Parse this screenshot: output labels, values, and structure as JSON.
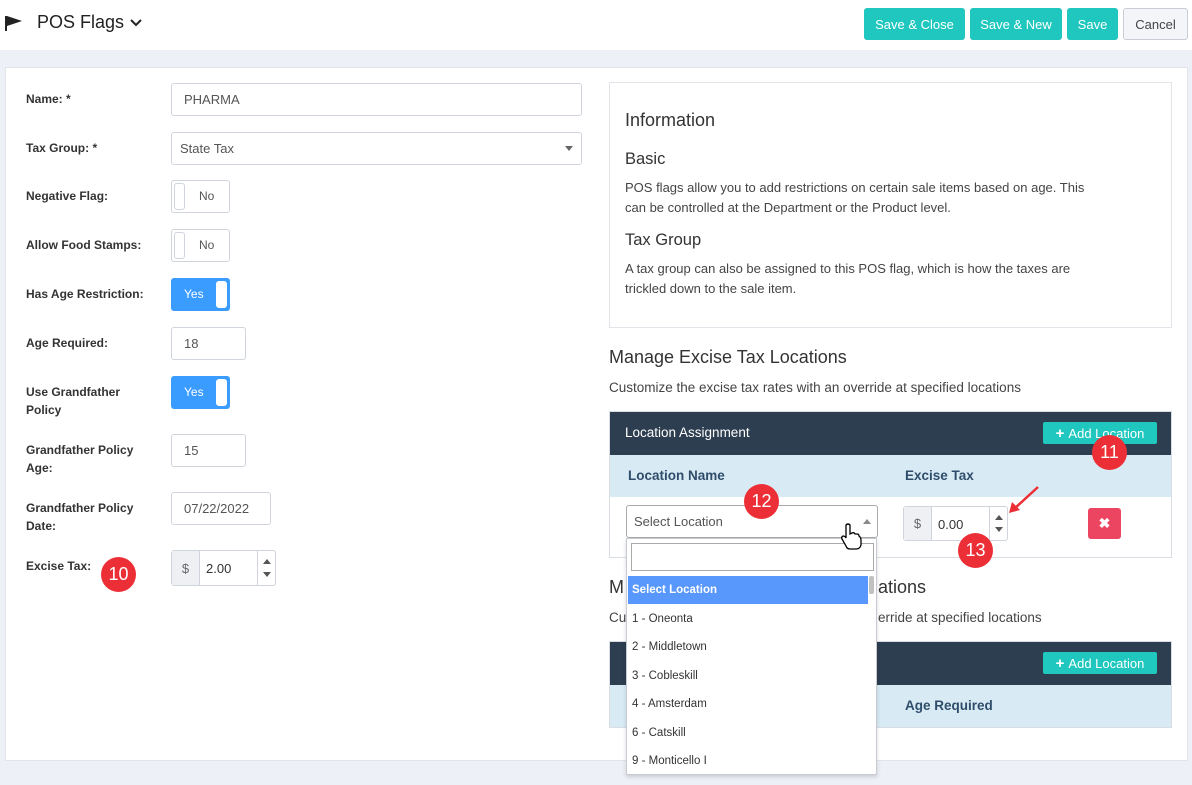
{
  "header": {
    "title": "POS Flags",
    "buttons": {
      "save_close": "Save & Close",
      "save_new": "Save & New",
      "save": "Save",
      "cancel": "Cancel"
    },
    "accent_color": "#1fc7be"
  },
  "form": {
    "name_label": "Name: *",
    "name_value": "PHARMA",
    "tax_group_label": "Tax Group: *",
    "tax_group_value": "State Tax",
    "negative_flag_label": "Negative Flag:",
    "negative_flag_value": "No",
    "food_stamps_label": "Allow Food Stamps:",
    "food_stamps_value": "No",
    "age_restriction_label": "Has Age Restriction:",
    "age_restriction_value": "Yes",
    "age_required_label": "Age Required:",
    "age_required_value": "18",
    "grandfather_label_1": "Use Grandfather",
    "grandfather_label_2": "Policy",
    "grandfather_value": "Yes",
    "gf_age_label_1": "Grandfather Policy",
    "gf_age_label_2": "Age:",
    "gf_age_value": "15",
    "gf_date_label_1": "Grandfather Policy",
    "gf_date_label_2": "Date:",
    "gf_date_value": "07/22/2022",
    "excise_label": "Excise Tax:",
    "currency_symbol": "$",
    "excise_value": "2.00"
  },
  "info": {
    "title": "Information",
    "basic_heading": "Basic",
    "basic_line1": "POS flags allow you to add restrictions on certain sale items based on age. This",
    "basic_line2": "can be controlled at the Department or the Product level.",
    "taxgroup_heading": "Tax Group",
    "taxgroup_line1": "A tax group can also be assigned to this POS flag, which is how the taxes are",
    "taxgroup_line2": "trickled down to the sale item."
  },
  "excise_section": {
    "title": "Manage Excise Tax Locations",
    "subtitle": "Customize the excise tax rates with an override at specified locations",
    "panel_title": "Location Assignment",
    "add_label": "Add Location",
    "col_location": "Location Name",
    "col_tax": "Excise Tax",
    "select_placeholder": "Select Location",
    "row_tax_value": "0.00",
    "delete_symbol": "✖"
  },
  "age_section": {
    "title_start": "M",
    "title_end": "ations",
    "subtitle_start": "Cu",
    "subtitle_end": "erride at specified locations",
    "add_label": "Add Location",
    "col_age": "Age Required"
  },
  "dropdown": {
    "options": [
      "Select Location",
      "1 - Oneonta",
      "2 - Middletown",
      "3 - Cobleskill",
      "4 - Amsterdam",
      "6 - Catskill",
      "9 - Monticello I"
    ]
  },
  "annotations": {
    "b10": "10",
    "b11": "11",
    "b12": "12",
    "b13": "13"
  }
}
